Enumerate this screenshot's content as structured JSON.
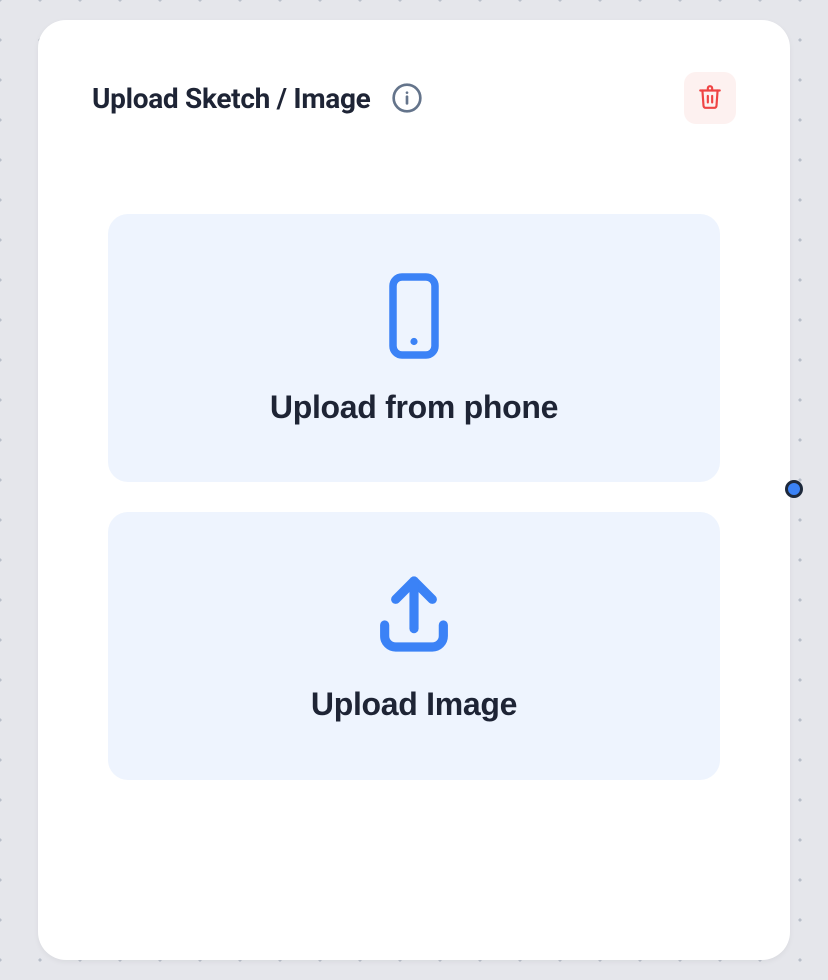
{
  "card": {
    "title": "Upload Sketch / Image"
  },
  "options": {
    "phone": {
      "label": "Upload from phone"
    },
    "image": {
      "label": "Upload Image"
    }
  }
}
